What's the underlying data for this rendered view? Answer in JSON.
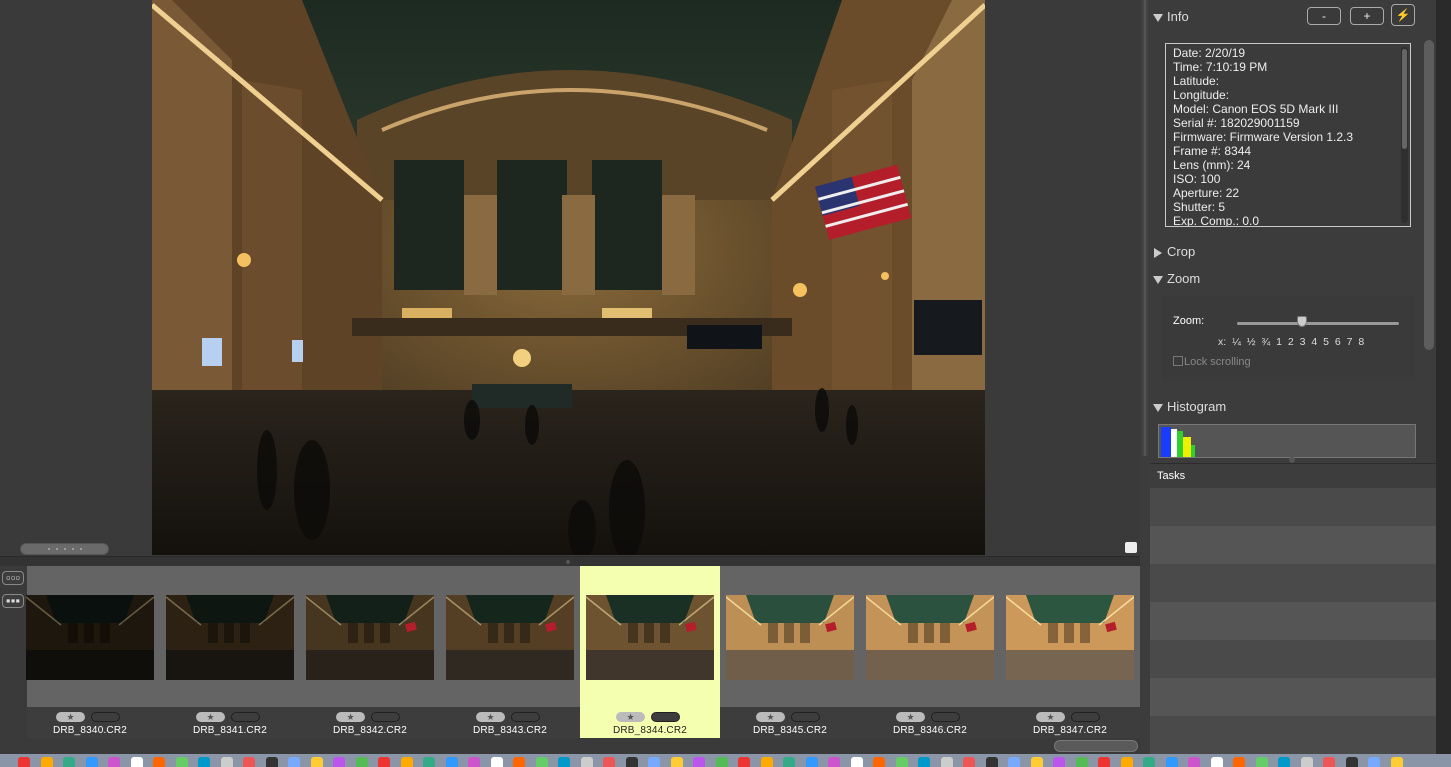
{
  "window": {
    "title": ""
  },
  "viewer": {
    "grip_icon": "resize-grip-icon",
    "corner_icon": "viewer-corner-icon"
  },
  "strip_tools": {
    "view_toggle_1": "▫▫▫",
    "view_toggle_2": "▪▪▪"
  },
  "filmstrip": {
    "items": [
      {
        "filename": "DRB_8340.CR2",
        "rating": "★",
        "brightness": 0.05,
        "selected": false
      },
      {
        "filename": "DRB_8341.CR2",
        "rating": "★",
        "brightness": 0.12,
        "selected": false
      },
      {
        "filename": "DRB_8342.CR2",
        "rating": "★",
        "brightness": 0.25,
        "selected": false
      },
      {
        "filename": "DRB_8343.CR2",
        "rating": "★",
        "brightness": 0.32,
        "selected": false
      },
      {
        "filename": "DRB_8344.CR2",
        "rating": "★",
        "brightness": 0.45,
        "selected": true
      },
      {
        "filename": "DRB_8345.CR2",
        "rating": "★",
        "brightness": 0.85,
        "selected": false
      },
      {
        "filename": "DRB_8346.CR2",
        "rating": "★",
        "brightness": 0.88,
        "selected": false
      },
      {
        "filename": "DRB_8347.CR2",
        "rating": "★",
        "brightness": 0.92,
        "selected": false
      }
    ]
  },
  "inspector": {
    "info": {
      "title": "Info",
      "minus_label": "-",
      "plus_label": "+",
      "action_icon": "lightning-icon",
      "lines": [
        "Date: 2/20/19",
        "Time: 7:10:19 PM",
        "Latitude:",
        "Longitude:",
        "Model: Canon EOS 5D Mark III",
        "Serial #: 182029001159",
        "Firmware: Firmware Version 1.2.3",
        "Frame #: 8344",
        "Lens (mm): 24",
        "ISO: 100",
        "Aperture: 22",
        "Shutter: 5",
        "Exp. Comp.: 0.0"
      ]
    },
    "crop": {
      "title": "Crop"
    },
    "zoom": {
      "title": "Zoom",
      "label": "Zoom:",
      "ticks": "x:  ¼  ½  ¾  1  2  3  4  5  6  7  8",
      "value_fraction": 0.4,
      "lock_label": "Lock scrolling",
      "lock_checked": false
    },
    "histogram": {
      "title": "Histogram"
    }
  },
  "tasks": {
    "title": "Tasks",
    "rows": 7
  },
  "colors": {
    "selected_thumb": "#f4ffb0",
    "panel_bg": "#3c3c3c"
  }
}
